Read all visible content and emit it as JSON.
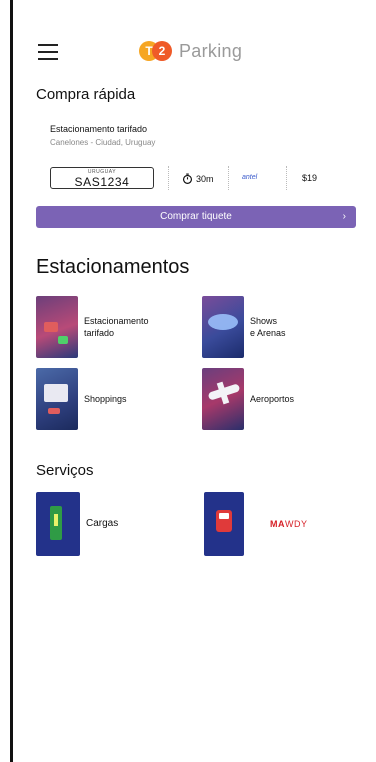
{
  "header": {
    "logo_left": "T",
    "logo_right": "2",
    "brand_name": "Parking"
  },
  "quick_purchase": {
    "title": "Compra rápida",
    "parking_name": "Estacionamento tarifado",
    "location": "Canelones - Ciudad, Uruguay",
    "plate_country": "URUGUAY",
    "plate_number": "SAS1234",
    "duration": "30m",
    "operator": "antel",
    "price": "$19",
    "button_label": "Comprar tiquete",
    "button_chevron": "›"
  },
  "parking": {
    "title": "Estacionamentos",
    "items": [
      {
        "label": "Estacionamento\ntarifado",
        "icon": "street-parking-icon"
      },
      {
        "label": "Shows\ne Arenas",
        "icon": "arena-icon"
      },
      {
        "label": "Shoppings",
        "icon": "shopping-icon"
      },
      {
        "label": "Aeroportos",
        "icon": "airport-icon"
      }
    ]
  },
  "services": {
    "title": "Serviços",
    "items": [
      {
        "label": "Cargas",
        "icon": "ev-charger-icon"
      },
      {
        "label_brand_a": "MA",
        "label_brand_b": "WDY",
        "icon": "tow-truck-icon"
      }
    ]
  },
  "colors": {
    "accent": "#7b63b5",
    "logo_orange": "#f6a623",
    "logo_red": "#ef5a28"
  }
}
